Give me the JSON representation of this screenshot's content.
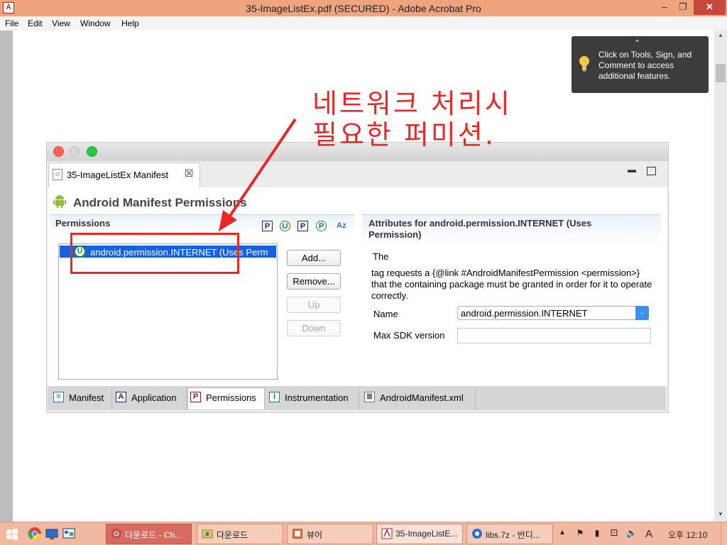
{
  "window": {
    "title": "35-ImageListEx.pdf (SECURED) - Adobe Acrobat Pro",
    "min_glyph": "–",
    "max_glyph": "❐",
    "close_glyph": "✕"
  },
  "menu": [
    "File",
    "Edit",
    "View",
    "Window",
    "Help"
  ],
  "tooltip": {
    "caret": "⌃",
    "text": "Click on Tools, Sign, and Comment to access additional features."
  },
  "annotation": {
    "line1": "네트워크 처리시",
    "line2": "필요한 퍼미션.",
    "color": "#e8292a"
  },
  "editor": {
    "tab_label": "35-ImageListEx Manifest",
    "tab_close": "☒",
    "tab_icon": "cl",
    "page_heading": "Android Manifest Permissions",
    "permissions": {
      "title": "Permissions",
      "toolbar": [
        "P",
        "U",
        "P",
        "P",
        "Az"
      ],
      "items": [
        {
          "icon": "U",
          "label": "android.permission.INTERNET (Uses Perm"
        }
      ],
      "buttons": {
        "add": "Add...",
        "remove": "Remove...",
        "up": "Up",
        "down": "Down"
      }
    },
    "attributes": {
      "title": "Attributes for android.permission.INTERNET (Uses Permission)",
      "lead": "The",
      "description": "tag requests a {@link #AndroidManifestPermission <permission>} that the containing package must be granted in order for it to operate correctly.",
      "name_label": "Name",
      "name_value": "android.permission.INTERNET",
      "select_arrow": "⌄",
      "sdk_label": "Max SDK version",
      "sdk_value": ""
    },
    "page_tabs": [
      {
        "icon": "≡",
        "label": "Manifest"
      },
      {
        "icon": "A",
        "label": "Application"
      },
      {
        "icon": "P",
        "label": "Permissions"
      },
      {
        "icon": "I",
        "label": "Instrumentation"
      },
      {
        "icon": "≣",
        "label": "AndroidManifest.xml"
      }
    ]
  },
  "taskbar": {
    "tasks": [
      {
        "label": "다운로드 - Ch..."
      },
      {
        "label": "다운로드"
      },
      {
        "label": "뷰어"
      },
      {
        "label": "35-ImageListE..."
      },
      {
        "label": "libs.7z - 반디..."
      }
    ],
    "tray_up": "▲",
    "tray_icons": [
      "⚑",
      "▮",
      "⚀",
      "🔈",
      "A"
    ],
    "clock": "오후 12:10"
  }
}
